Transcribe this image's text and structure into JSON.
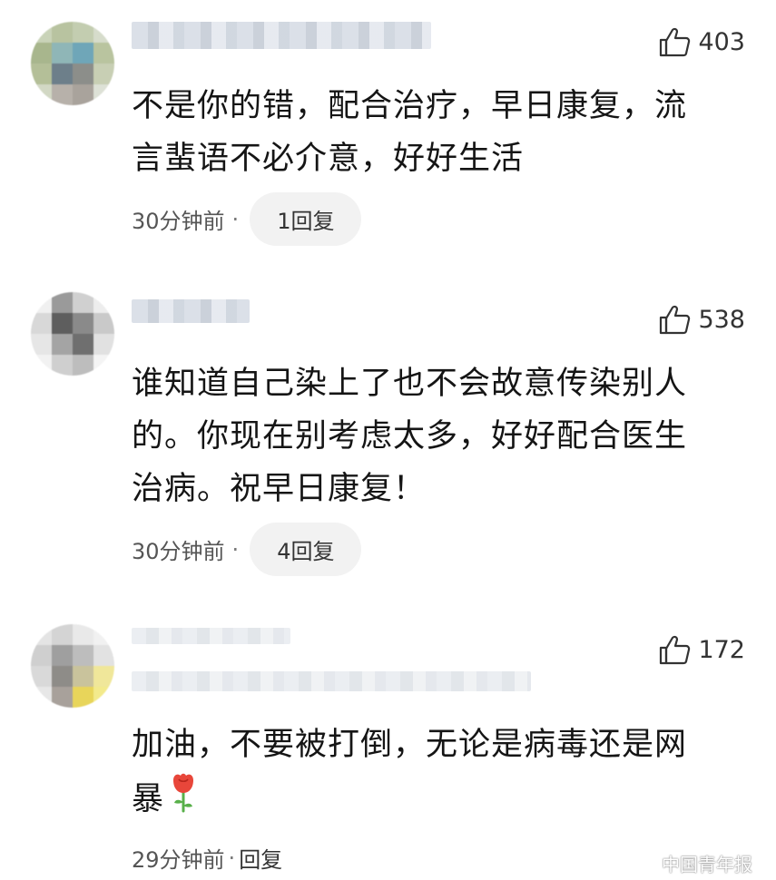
{
  "comments": [
    {
      "likes": "403",
      "text_lines": [
        "不是你的错，配合治疗，早日康复，流",
        "言蜚语不必介意，好好生活"
      ],
      "time": "30分钟前",
      "replies": "1回复"
    },
    {
      "likes": "538",
      "text_lines": [
        "谁知道自己染上了也不会故意传染别人",
        "的。你现在别考虑太多，好好配合医生",
        "治病。祝早日康复！"
      ],
      "time": "30分钟前",
      "replies": "4回复"
    },
    {
      "likes": "172",
      "text_lines": [
        "加油，不要被打倒，无论是病毒还是网",
        "暴"
      ],
      "time": "29分钟前",
      "replies": "回复"
    }
  ],
  "separator": "·",
  "watermark": "中国青年报",
  "icons": {
    "like": "thumbs-up-icon",
    "flower": "rose-icon",
    "watermark_logo": "wechat-logo-icon"
  },
  "colors": {
    "text": "#151515",
    "meta": "#555555",
    "pill_bg": "#f2f2f2",
    "rose": "#e8463a",
    "leaf": "#58b04a"
  }
}
